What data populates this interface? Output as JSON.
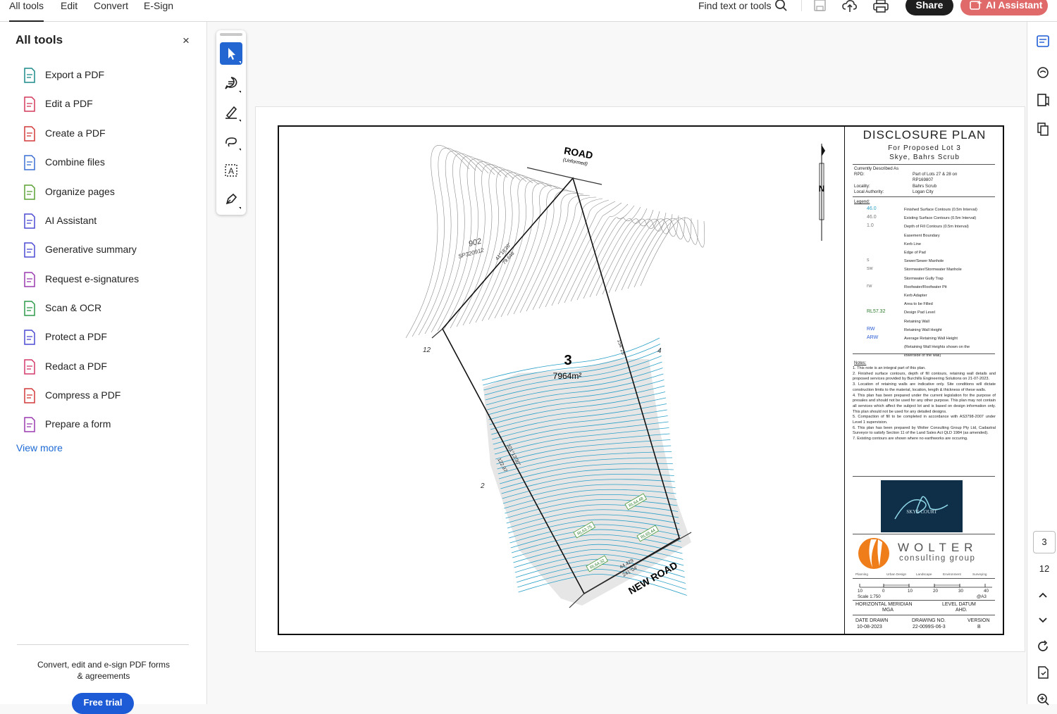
{
  "menu": {
    "tabs": [
      "All tools",
      "Edit",
      "Convert",
      "E-Sign"
    ],
    "search_label": "Find text or tools",
    "share_label": "Share",
    "ai_label": "AI Assistant"
  },
  "left_panel": {
    "title": "All tools",
    "close_glyph": "×",
    "tools": [
      {
        "label": "Export a PDF",
        "icon": "export-pdf-icon",
        "color": "#1b8a8a"
      },
      {
        "label": "Edit a PDF",
        "icon": "edit-pdf-icon",
        "color": "#d33a5a"
      },
      {
        "label": "Create a PDF",
        "icon": "create-pdf-icon",
        "color": "#d33a3a"
      },
      {
        "label": "Combine files",
        "icon": "combine-files-icon",
        "color": "#3a6fd3"
      },
      {
        "label": "Organize pages",
        "icon": "organize-pages-icon",
        "color": "#5aa032"
      },
      {
        "label": "AI Assistant",
        "icon": "ai-assistant-icon",
        "color": "#4a4ad3"
      },
      {
        "label": "Generative summary",
        "icon": "generative-summary-icon",
        "color": "#4a4ad3"
      },
      {
        "label": "Request e-signatures",
        "icon": "request-esignatures-icon",
        "color": "#9a3ab0"
      },
      {
        "label": "Scan & OCR",
        "icon": "scan-ocr-icon",
        "color": "#2f9a4a"
      },
      {
        "label": "Protect a PDF",
        "icon": "protect-pdf-icon",
        "color": "#4a4ad3"
      },
      {
        "label": "Redact a PDF",
        "icon": "redact-pdf-icon",
        "color": "#d33a6a"
      },
      {
        "label": "Compress a PDF",
        "icon": "compress-pdf-icon",
        "color": "#d33a3a"
      },
      {
        "label": "Prepare a form",
        "icon": "prepare-form-icon",
        "color": "#9a3ab0"
      }
    ],
    "view_more": "View more",
    "promo_line1": "Convert, edit and e-sign PDF forms",
    "promo_line2": "& agreements",
    "trial_label": "Free trial"
  },
  "document": {
    "road_top": "ROAD",
    "road_top_sub": "(Unformed)",
    "road_bottom": "NEW ROAD",
    "north": "N",
    "lot_number": "3",
    "lot_area": "7964m²",
    "lot_left": "902",
    "plan_ref": "SP320912",
    "bearing_top": "41°18'20\"",
    "dist_top": "79.648",
    "bearing_right": "154°25'",
    "dist_right": "45",
    "bearing_left": "321°13'30\"",
    "dist_left": "122.97",
    "bearing_bottom": "44.429",
    "dist_bottom": "241°04'",
    "adj_lot_2": "2",
    "adj_lot_4": "4",
    "adj_lot_12": "12",
    "rl_1": "RL63.75",
    "rl_2": "RL64.48",
    "rl_3": "RL64.32",
    "rl_4": "RL65.44"
  },
  "title_block": {
    "title": "DISCLOSURE  PLAN",
    "sub1": "For  Proposed  Lot   3",
    "sub2": "Skye,  Bahrs  Scrub",
    "described": "Currently  Described  As",
    "rpd_label": "RPD:",
    "rpd_value1": "Part  of  Lots  27  &  28  on",
    "rpd_value2": "RP169807",
    "locality_label": "Locality:",
    "locality_value": "Bahrs  Scrub",
    "authority_label": "Local  Authority:",
    "authority_value": "Logan  City",
    "legend_title": "Legend:",
    "legend": [
      {
        "sample": "46.0",
        "label": "Finished  Surface  Contours  (0.5m  Interval)"
      },
      {
        "sample": "46.0",
        "label": "Existing  Surface  Contours  (0.5m  Interval)"
      },
      {
        "sample": "1.0",
        "label": "Depth  of  Fill  Contours  (0.5m  Interval)"
      },
      {
        "sample": "",
        "label": "Easement  Boundary"
      },
      {
        "sample": "",
        "label": "Kerb  Line"
      },
      {
        "sample": "",
        "label": "Edge  of  Pad"
      },
      {
        "sample": "s",
        "label": "Sewer/Sewer  Manhole"
      },
      {
        "sample": "sw",
        "label": "Stormwater/Stormwater  Manhole"
      },
      {
        "sample": "",
        "label": "Stormwater  Gully  Trap"
      },
      {
        "sample": "rw",
        "label": "Roofwater/Roofwater  Pit"
      },
      {
        "sample": "",
        "label": "Kerb  Adapter"
      },
      {
        "sample": "",
        "label": "Area  to  be  Filled"
      },
      {
        "sample": "RL57.32",
        "label": "Design  Pad  Level"
      },
      {
        "sample": "",
        "label": "Retaining  Wall"
      },
      {
        "sample": "RW",
        "label": "Retaining  Wall  Height"
      },
      {
        "sample": "ARW",
        "label": "Average  Retaining  Wall  Height"
      },
      {
        "sample": "",
        "label": "(Retaining  Wall  Heights  shown  on  the"
      },
      {
        "sample": "",
        "label": "lowerside  of  the  wall)"
      }
    ],
    "notes_title": "Notes:",
    "notes": [
      "1.  This  note  is  an  integral  part  of  this  plan.",
      "2.  Finished  surface  contours,  depth  of  fill  contours,  retaining  wall  details  and  proposed  services  provided  by  Burchills  Engineering  Solutions  on  21-07-2023.",
      "3.  Location  of  retaining  walls  are  indicative  only.  Site  conditions  will  dictate  construction  limits  to  the  material,  location,  length  &  thickness  of  these  walls.",
      "4.  This  plan  has  been  prepared  under  the  current  legislation  for  the  purpose  of  presales  and  should  not  be  used  for  any  other  purpose.  This  plan  may  not  contain  all  services  which  affect  the  subject  lot  and  is  based  on  design  information  only.  This  plan  should  not  be  used  for  any  detailed  designs.",
      "5.  Compaction  of  fill  to  be  completed  in  accordance  with  AS3798-2007  under  Level  1  supervision.",
      "6.  This  plan  has  been  prepared  by  Wolter  Consulting  Group  Pty  Ltd,  Cadastral  Surveyor  to  satisfy  Section  11  of  the  Land  Sales  Act  QLD  1984  (as  amended).",
      "7.  Existing  contours  are  shown  where  no  earthworks  are  occuring."
    ],
    "logo_text": "SKYE COURT",
    "company1": "WOLTER",
    "company2": "consulting group",
    "services": [
      "Planning",
      "Urban Design",
      "Landscape",
      "Environment",
      "Surveying"
    ],
    "scale_ticks": [
      "10",
      "0",
      "10",
      "20",
      "30",
      "40"
    ],
    "scale_label": "Scale  1:750",
    "scale_size": "@A3",
    "meridian_label": "HORIZONTAL  MERIDIAN",
    "meridian_value": "MGA",
    "datum_label": "LEVEL  DATUM",
    "datum_value": "AHD.",
    "date_label": "DATE  DRAWN",
    "date_value": "10-08-2023",
    "drawing_label": "DRAWING  NO.",
    "drawing_value": "22-0099S-06-3",
    "version_label": "VERSION",
    "version_value": "B"
  },
  "right_rail": {
    "current_page": "3",
    "total_pages": "12"
  },
  "colors": {
    "accent_blue": "#2366d1",
    "ai_button": "#e06a6a",
    "fill_contours": "#2aa0c8",
    "existing_contours": "#8a8a8a"
  }
}
